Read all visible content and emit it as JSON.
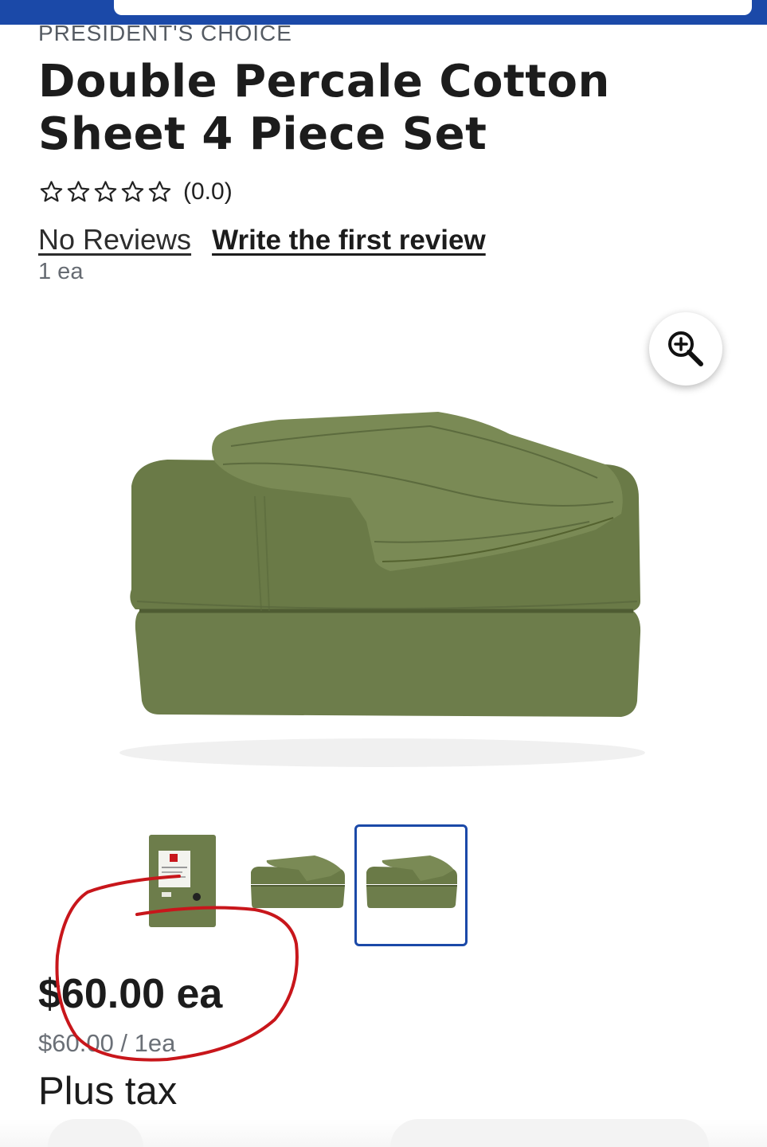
{
  "header": {
    "brand": "PRESIDENT'S CHOICE",
    "title": "Double Percale Cotton Sheet 4 Piece Set"
  },
  "rating": {
    "stars_filled": 0,
    "stars_total": 5,
    "value_text": "(0.0)"
  },
  "reviews": {
    "no_reviews_label": "No Reviews",
    "write_review_label": "Write the first review"
  },
  "product": {
    "unit_text": "1 ea",
    "sheet_color": "#6d7d4b",
    "thumbnails_count": 3,
    "selected_thumbnail_index": 2
  },
  "pricing": {
    "price": "$60.00 ea",
    "unit_price": "$60.00 / 1ea",
    "tax_note": "Plus tax"
  },
  "colors": {
    "brand_blue": "#1b49a8",
    "annotation_red": "#c8161b"
  },
  "icons": {
    "zoom": "zoom-in-icon",
    "star": "star-outline-icon"
  }
}
